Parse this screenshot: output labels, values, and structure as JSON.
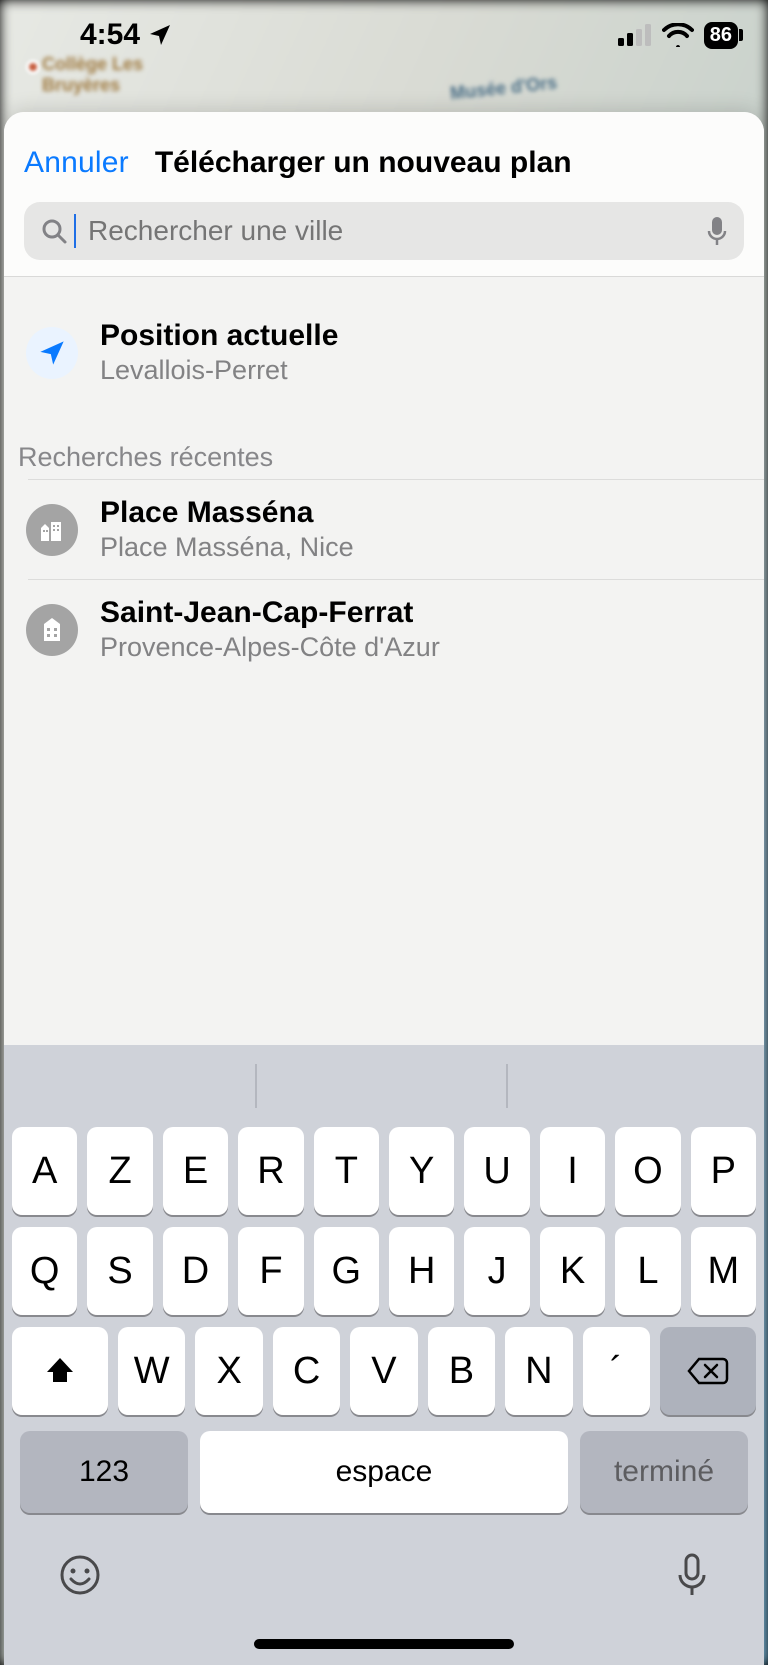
{
  "status": {
    "time": "4:54",
    "battery": "86"
  },
  "map": {
    "label_left": "Collège Les\nBruyères",
    "label_right": "Musée d'Ors"
  },
  "header": {
    "cancel": "Annuler",
    "title": "Télécharger un nouveau plan"
  },
  "search": {
    "placeholder": "Rechercher une ville",
    "value": ""
  },
  "current": {
    "title": "Position actuelle",
    "subtitle": "Levallois-Perret"
  },
  "recent": {
    "header": "Recherches récentes",
    "items": [
      {
        "title": "Place Masséna",
        "subtitle": "Place Masséna, Nice"
      },
      {
        "title": "Saint-Jean-Cap-Ferrat",
        "subtitle": "Provence-Alpes-Côte d'Azur"
      }
    ]
  },
  "keyboard": {
    "row1": [
      "A",
      "Z",
      "E",
      "R",
      "T",
      "Y",
      "U",
      "I",
      "O",
      "P"
    ],
    "row2": [
      "Q",
      "S",
      "D",
      "F",
      "G",
      "H",
      "J",
      "K",
      "L",
      "M"
    ],
    "row3": [
      "W",
      "X",
      "C",
      "V",
      "B",
      "N",
      "´"
    ],
    "num": "123",
    "space": "espace",
    "done": "terminé"
  }
}
